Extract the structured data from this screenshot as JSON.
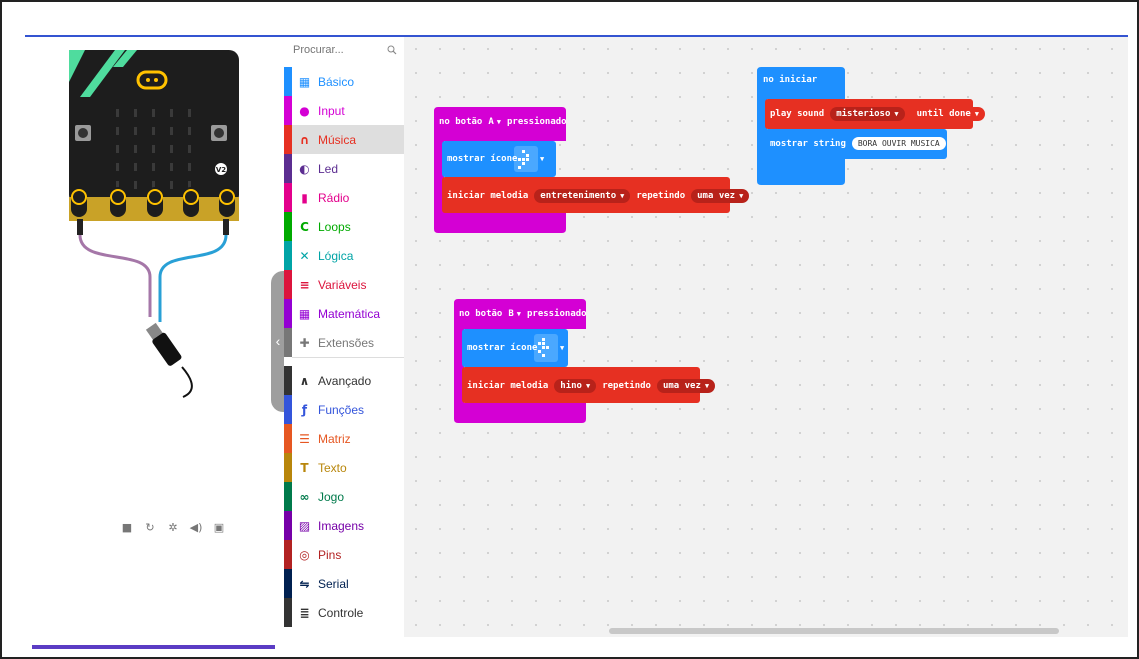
{
  "search": {
    "placeholder": "Procurar..."
  },
  "simulator": {
    "pins": [
      "0",
      "1",
      "2",
      "3V",
      "GND"
    ],
    "version_badge": "V2",
    "controls": [
      "stop-icon",
      "restart-icon",
      "debug-icon",
      "sound-icon",
      "fullscreen-icon"
    ]
  },
  "toolbox": {
    "categories": [
      {
        "label": "Básico",
        "color": "#1e90ff",
        "icon": "grid-icon"
      },
      {
        "label": "Input",
        "color": "#d400d4",
        "icon": "input-icon"
      },
      {
        "label": "Música",
        "color": "#e63022",
        "icon": "headphones-icon"
      },
      {
        "label": "Led",
        "color": "#5c2d91",
        "icon": "led-icon"
      },
      {
        "label": "Rádio",
        "color": "#e3008c",
        "icon": "signal-icon"
      },
      {
        "label": "Loops",
        "color": "#00aa00",
        "icon": "loop-icon"
      },
      {
        "label": "Lógica",
        "color": "#00a4a6",
        "icon": "shuffle-icon"
      },
      {
        "label": "Variáveis",
        "color": "#dc143c",
        "icon": "list-icon"
      },
      {
        "label": "Matemática",
        "color": "#9400d3",
        "icon": "calculator-icon"
      },
      {
        "label": "Extensões",
        "color": "#777777",
        "icon": "plus-circle-icon"
      },
      {
        "label": "Avançado",
        "color": "#333333",
        "icon": "chevron-up-icon"
      },
      {
        "label": "Funções",
        "color": "#3455db",
        "icon": "function-icon"
      },
      {
        "label": "Matriz",
        "color": "#e65722",
        "icon": "array-icon"
      },
      {
        "label": "Texto",
        "color": "#b8860b",
        "icon": "text-icon"
      },
      {
        "label": "Jogo",
        "color": "#007a4b",
        "icon": "gamepad-icon"
      },
      {
        "label": "Imagens",
        "color": "#7600a8",
        "icon": "image-icon"
      },
      {
        "label": "Pins",
        "color": "#b22222",
        "icon": "pin-icon"
      },
      {
        "label": "Serial",
        "color": "#002050",
        "icon": "usb-icon"
      },
      {
        "label": "Controle",
        "color": "#333333",
        "icon": "control-icon"
      }
    ]
  },
  "blocks": {
    "on_start": {
      "label": "no iniciar",
      "play_sound": "play sound",
      "sound": "misterioso",
      "until": "until done",
      "show_string": "mostrar string",
      "string_value": "BORA OUVIR MUSICA"
    },
    "button_a": {
      "label_pre": "no botão",
      "button": "A",
      "label_post": "pressionado",
      "show_icon": "mostrar ícone",
      "start_melody": "iniciar melodia",
      "melody": "entretenimento",
      "repeating": "repetindo",
      "repeat_value": "uma vez"
    },
    "button_b": {
      "label_pre": "no botão",
      "button": "B",
      "label_post": "pressionado",
      "show_icon": "mostrar ícone",
      "start_melody": "iniciar melodia",
      "melody": "hino",
      "repeating": "repetindo",
      "repeat_value": "uma vez"
    }
  },
  "colors": {
    "input": "#d400d4",
    "music": "#e63022",
    "basic": "#1e90ff",
    "accent": "#3454d1"
  }
}
